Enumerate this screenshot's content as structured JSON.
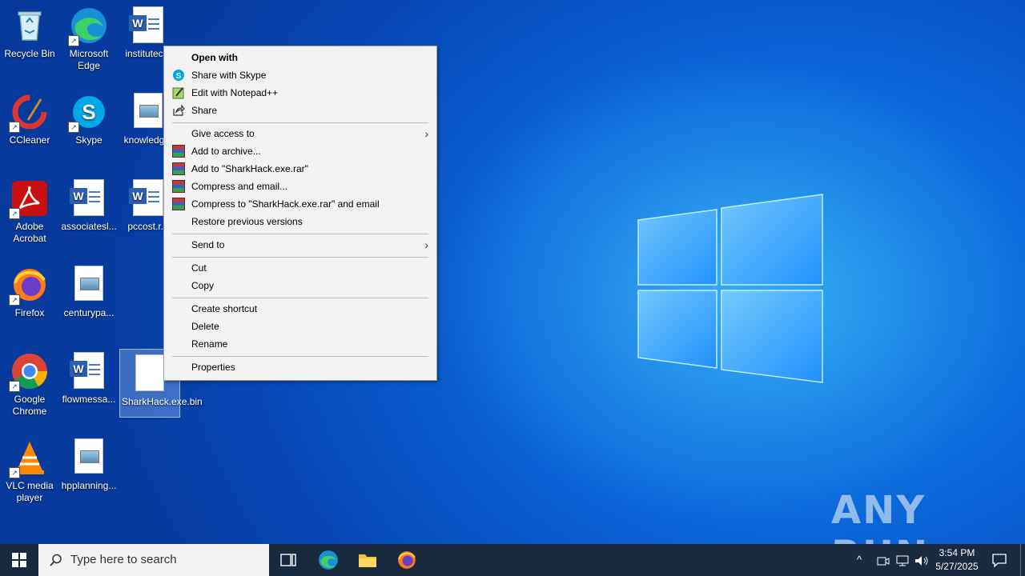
{
  "desktop": {
    "icons": [
      {
        "label": "Recycle Bin"
      },
      {
        "label": "Microsoft Edge"
      },
      {
        "label": "institutec..."
      },
      {
        "label": "CCleaner"
      },
      {
        "label": "Skype"
      },
      {
        "label": "knowledg..."
      },
      {
        "label": "Adobe Acrobat"
      },
      {
        "label": "associatesl..."
      },
      {
        "label": "pccost.r..."
      },
      {
        "label": "Firefox"
      },
      {
        "label": "centurypa..."
      },
      {
        "label": "Google Chrome"
      },
      {
        "label": "flowmessa..."
      },
      {
        "label": "SharkHack.exe.bin"
      },
      {
        "label": "VLC media player"
      },
      {
        "label": "hpplanning..."
      }
    ]
  },
  "context_menu": {
    "items": [
      {
        "label": "Open with",
        "icon": ""
      },
      {
        "label": "Share with Skype",
        "icon": "skype-icon"
      },
      {
        "label": "Edit with Notepad++",
        "icon": "notepadpp-icon"
      },
      {
        "label": "Share",
        "icon": "share-icon"
      },
      {
        "label": "Give access to",
        "icon": ""
      },
      {
        "label": "Add to archive...",
        "icon": "winrar-icon"
      },
      {
        "label": "Add to \"SharkHack.exe.rar\"",
        "icon": "winrar-icon"
      },
      {
        "label": "Compress and email...",
        "icon": "winrar-icon"
      },
      {
        "label": "Compress to \"SharkHack.exe.rar\" and email",
        "icon": "winrar-icon"
      },
      {
        "label": "Restore previous versions",
        "icon": ""
      },
      {
        "label": "Send to",
        "icon": ""
      },
      {
        "label": "Cut",
        "icon": ""
      },
      {
        "label": "Copy",
        "icon": ""
      },
      {
        "label": "Create shortcut",
        "icon": ""
      },
      {
        "label": "Delete",
        "icon": ""
      },
      {
        "label": "Rename",
        "icon": ""
      },
      {
        "label": "Properties",
        "icon": ""
      }
    ]
  },
  "taskbar": {
    "search_placeholder": "Type here to search",
    "time": "3:54 PM",
    "date": "5/27/2025"
  },
  "watermark": "ANY RUN",
  "colors": {
    "accent": "#0a66d8",
    "taskbar": "#1a2a3e",
    "menu_bg": "#f2f2f2"
  }
}
